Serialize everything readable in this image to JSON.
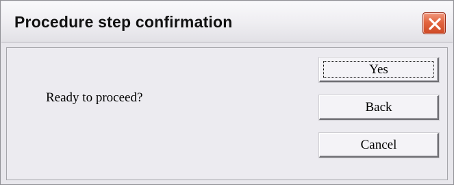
{
  "window": {
    "title": "Procedure step confirmation",
    "close_icon": "close-icon"
  },
  "message": {
    "text": "Ready to proceed?"
  },
  "buttons": {
    "yes": "Yes",
    "back": "Back",
    "cancel": "Cancel"
  },
  "colors": {
    "dialog_background": "#e8e7ec",
    "close_button": "#e2653f"
  }
}
